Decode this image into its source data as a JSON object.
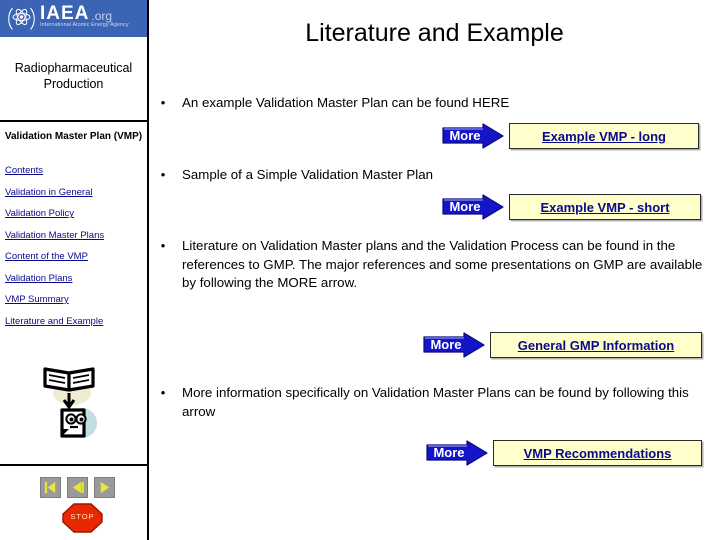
{
  "sidebar": {
    "logo": {
      "emblem_icon": "iaea-atom-emblem-icon",
      "name": "IAEA",
      "domain": ".org",
      "subtitle": "International Atomic Energy Agency"
    },
    "section_title": "Radiopharmaceutical Production",
    "nav_heading": "Validation Master Plan (VMP)",
    "nav_items": [
      {
        "label": "Contents"
      },
      {
        "label": "Validation in General"
      },
      {
        "label": "Validation Policy"
      },
      {
        "label": "Validation Master Plans"
      },
      {
        "label": "Content of the VMP"
      },
      {
        "label": "Validation Plans"
      },
      {
        "label": "VMP Summary"
      },
      {
        "label": "Literature and Example"
      }
    ],
    "reader_icon": "open-book-and-reading-page-icon",
    "nav_buttons": [
      {
        "name": "first-slide-button",
        "icon": "skip-to-first-icon"
      },
      {
        "name": "previous-slide-button",
        "icon": "previous-arrow-icon"
      },
      {
        "name": "next-slide-button",
        "icon": "next-arrow-icon"
      }
    ],
    "stop_button": {
      "label": "STOP",
      "icon": "stop-octagon-icon"
    }
  },
  "main": {
    "title": "Literature and Example",
    "bullets": [
      {
        "text": "An example Validation Master Plan can be found HERE"
      },
      {
        "text": "Sample of a Simple Validation Master Plan"
      },
      {
        "text": "Literature on Validation Master plans and the Validation Process can be found in the references to GMP. The major references and some presentations on GMP are available by following the MORE arrow."
      },
      {
        "text": "More information specifically on Validation Master Plans can be found by following this arrow"
      }
    ],
    "more_links": [
      {
        "arrow_label": "More",
        "link_label": "Example VMP - long"
      },
      {
        "arrow_label": "More",
        "link_label": "Example VMP - short"
      },
      {
        "arrow_label": "More",
        "link_label": "General GMP Information"
      },
      {
        "arrow_label": "More",
        "link_label": "VMP Recommendations"
      }
    ]
  },
  "colors": {
    "logo_band": "#3b64b4",
    "link_blue": "#0a0a8c",
    "arrow_blue": "#1414c8",
    "arrow_blue_dark": "#0a0a96",
    "link_box_bg": "#ffffcc",
    "stop_red": "#e82800"
  }
}
